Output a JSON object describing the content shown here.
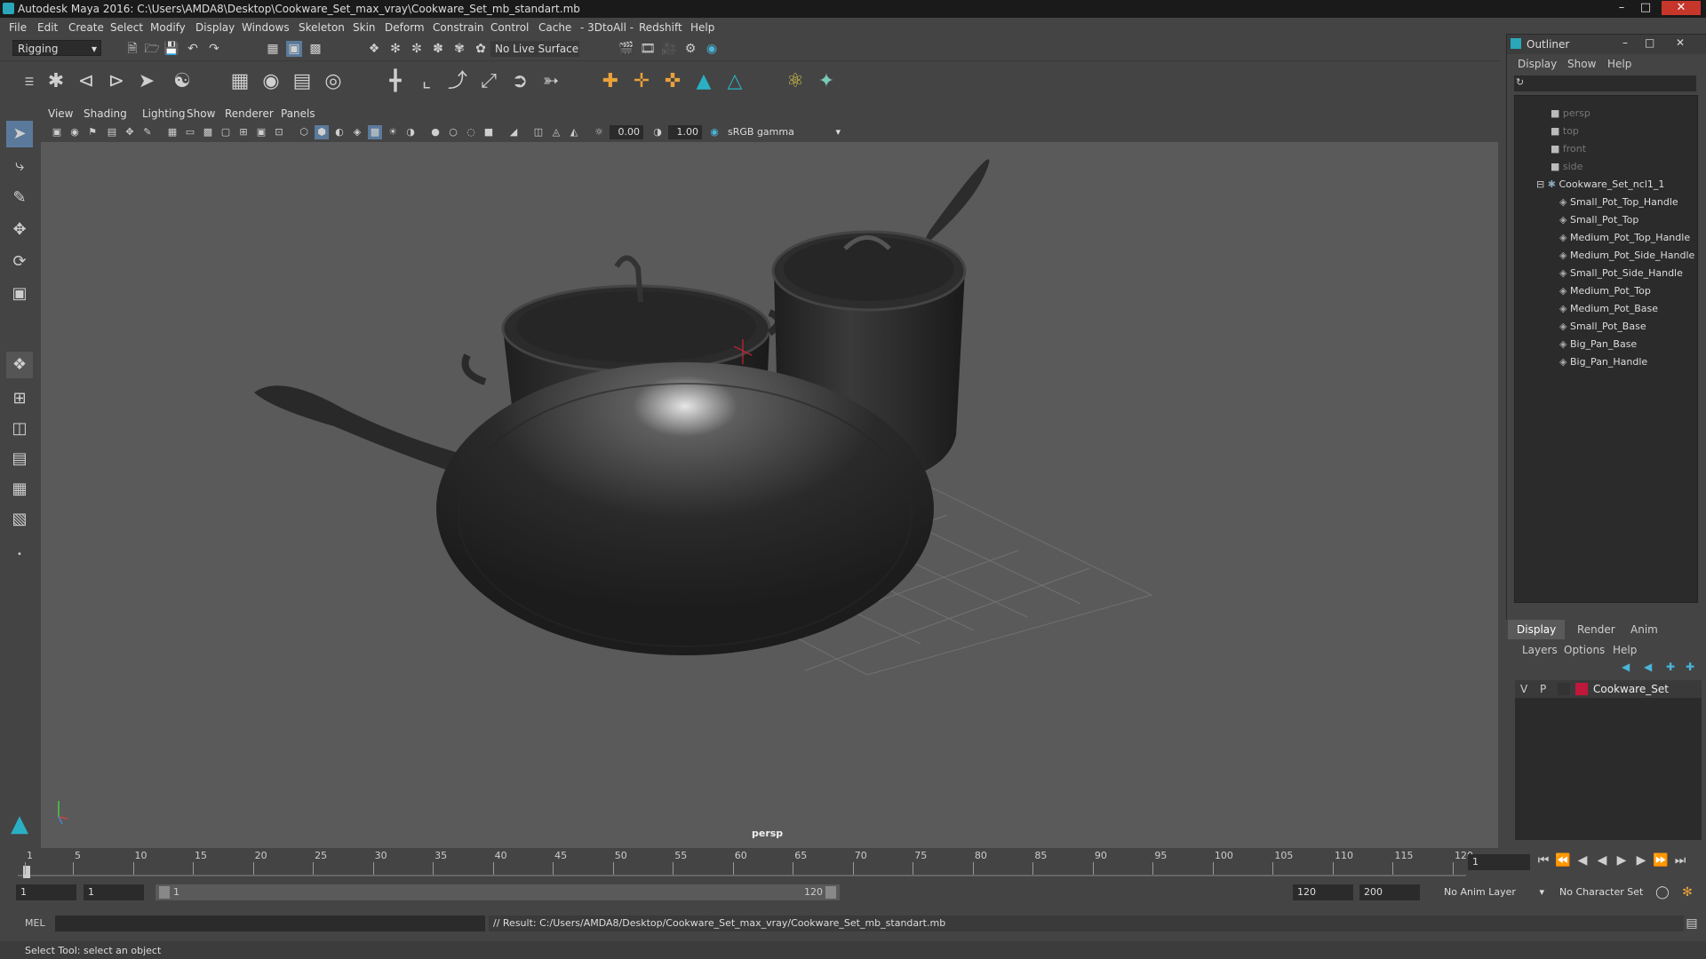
{
  "window": {
    "title": "Autodesk Maya 2016: C:\\Users\\AMDA8\\Desktop\\Cookware_Set_max_vray\\Cookware_Set_mb_standart.mb"
  },
  "menubar": [
    "File",
    "Edit",
    "Create",
    "Select",
    "Modify",
    "Display",
    "Windows",
    "Skeleton",
    "Skin",
    "Deform",
    "Constrain",
    "Control",
    "Cache",
    "- 3DtoAll -",
    "Redshift",
    "Help"
  ],
  "toolbar": {
    "mode": "Rigging",
    "live_surface": "No Live Surface"
  },
  "panel": {
    "menu": [
      "View",
      "Shading",
      "Lighting",
      "Show",
      "Renderer",
      "Panels"
    ],
    "near_value": "0.00",
    "far_value": "1.00",
    "color_space": "sRGB gamma",
    "camera_label": "persp"
  },
  "outliner": {
    "title": "Outliner",
    "menu": [
      "Display",
      "Show",
      "Help"
    ],
    "items": [
      {
        "label": "persp",
        "depth": 0,
        "dim": true
      },
      {
        "label": "top",
        "depth": 0,
        "dim": true
      },
      {
        "label": "front",
        "depth": 0,
        "dim": true
      },
      {
        "label": "side",
        "depth": 0,
        "dim": true
      },
      {
        "label": "Cookware_Set_ncl1_1",
        "depth": 0,
        "dim": false
      },
      {
        "label": "Small_Pot_Top_Handle",
        "depth": 1,
        "dim": false
      },
      {
        "label": "Small_Pot_Top",
        "depth": 1,
        "dim": false
      },
      {
        "label": "Medium_Pot_Top_Handle",
        "depth": 1,
        "dim": false
      },
      {
        "label": "Medium_Pot_Side_Handle",
        "depth": 1,
        "dim": false
      },
      {
        "label": "Small_Pot_Side_Handle",
        "depth": 1,
        "dim": false
      },
      {
        "label": "Medium_Pot_Top",
        "depth": 1,
        "dim": false
      },
      {
        "label": "Medium_Pot_Base",
        "depth": 1,
        "dim": false
      },
      {
        "label": "Small_Pot_Base",
        "depth": 1,
        "dim": false
      },
      {
        "label": "Big_Pan_Base",
        "depth": 1,
        "dim": false
      },
      {
        "label": "Big_Pan_Handle",
        "depth": 1,
        "dim": false
      }
    ]
  },
  "layers": {
    "tabs": [
      "Display",
      "Render",
      "Anim"
    ],
    "menu": [
      "Layers",
      "Options",
      "Help"
    ],
    "layer": {
      "v": "V",
      "p": "P",
      "name": "Cookware_Set",
      "color": "#c0183a"
    }
  },
  "timeline": {
    "ticks": [
      "1",
      "5",
      "10",
      "15",
      "20",
      "25",
      "30",
      "35",
      "40",
      "45",
      "50",
      "55",
      "60",
      "65",
      "70",
      "75",
      "80",
      "85",
      "90",
      "95",
      "100",
      "105",
      "110",
      "115",
      "120"
    ],
    "current_frame": "1"
  },
  "range": {
    "start": "1",
    "current": "1",
    "slider_start": "1",
    "slider_end": "120",
    "end": "120",
    "max_end": "200",
    "anim_layer": "No Anim Layer",
    "character_set": "No Character Set"
  },
  "command": {
    "mode": "MEL",
    "result": "// Result: C:/Users/AMDA8/Desktop/Cookware_Set_max_vray/Cookware_Set_mb_standart.mb"
  },
  "help": {
    "text": "Select Tool: select an object"
  }
}
